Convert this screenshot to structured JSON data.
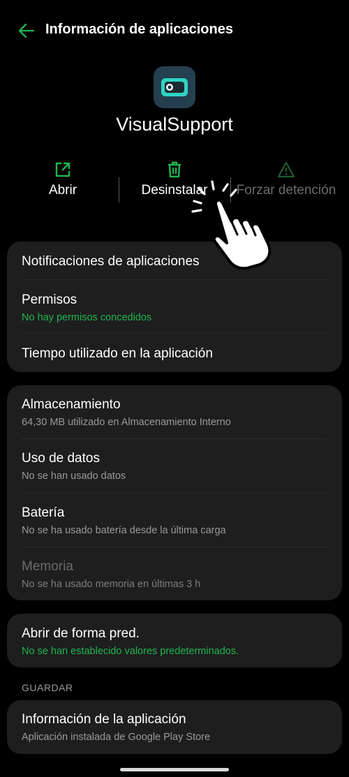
{
  "header": {
    "title": "Información de aplicaciones"
  },
  "app": {
    "name": "VisualSupport",
    "icon": "visualsupport-app-icon"
  },
  "actions": [
    {
      "label": "Abrir",
      "icon": "open-external-icon",
      "enabled": true
    },
    {
      "label": "Desinstalar",
      "icon": "trash-icon",
      "enabled": true
    },
    {
      "label": "Forzar detención",
      "icon": "warning-triangle-icon",
      "enabled": false
    }
  ],
  "cards": {
    "first": [
      {
        "title": "Notificaciones de aplicaciones"
      },
      {
        "title": "Permisos",
        "subtitle": "No hay permisos concedidos"
      },
      {
        "title": "Tiempo utilizado en la aplicación"
      }
    ],
    "second": [
      {
        "title": "Almacenamiento",
        "subtitle": "64,30 MB utilizado en Almacenamiento Interno"
      },
      {
        "title": "Uso de datos",
        "subtitle": "No se han usado datos"
      },
      {
        "title": "Batería",
        "subtitle": "No se ha usado batería desde la última carga"
      },
      {
        "title": "Memoria",
        "subtitle": "No se ha usado memoria en últimas 3 h"
      }
    ],
    "third": [
      {
        "title": "Abrir de forma pred.",
        "subtitle": "No se han establecido valores predeterminados."
      }
    ],
    "section_label": "GUARDAR",
    "fourth": [
      {
        "title": "Información de la aplicación",
        "subtitle": "Aplicación instalada de Google Play Store"
      }
    ]
  },
  "colors": {
    "background": "#000000",
    "card": "#1e1e1e",
    "accent_green": "#1fb54e",
    "text_secondary": "#9a9a9a",
    "text_disabled": "#6b6b6b"
  }
}
